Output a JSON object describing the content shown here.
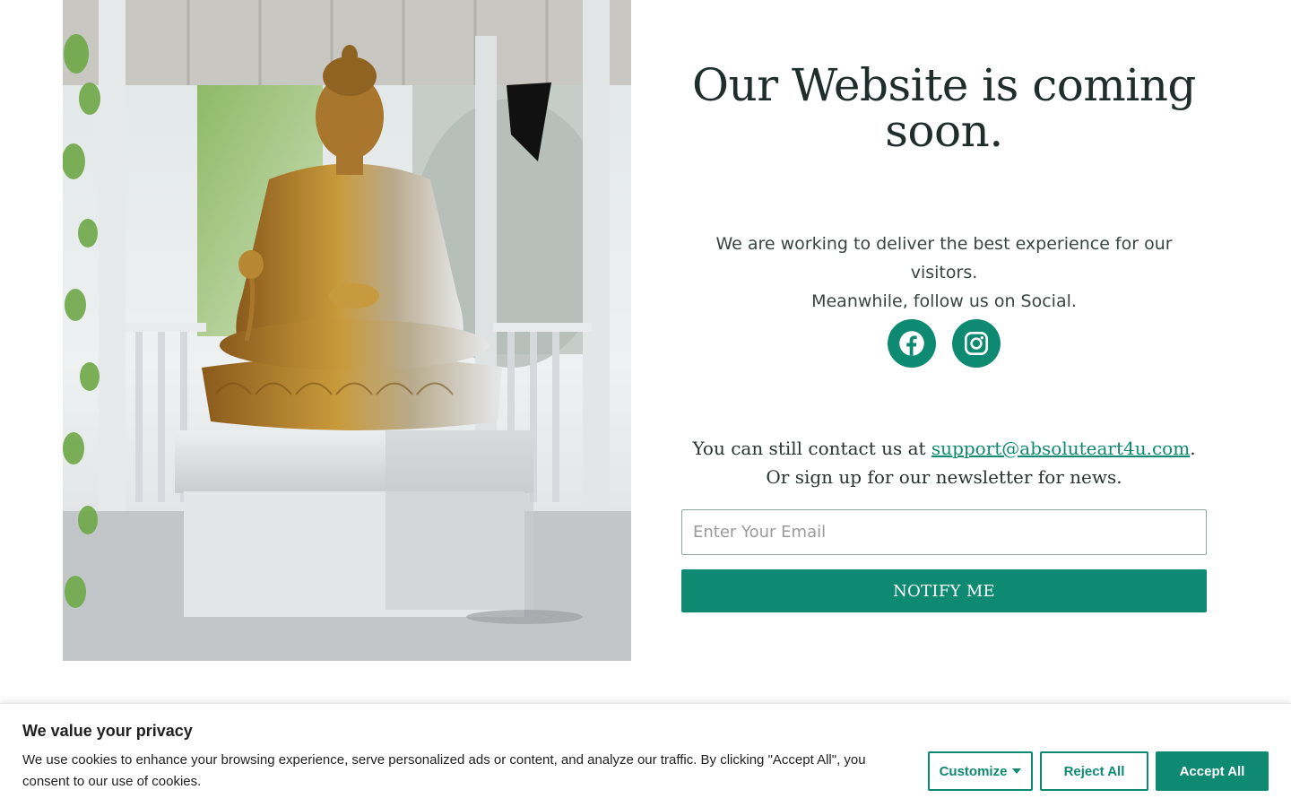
{
  "hero": {
    "alt": "Golden Buddha statue seated in a white gazebo surrounded by greenery"
  },
  "main": {
    "title": "Our Website is coming soon.",
    "intro_line1": "We are working to deliver the best experience for our visitors.",
    "intro_line2": "Meanwhile, follow us on Social.",
    "socials": [
      {
        "name": "facebook-icon",
        "label": "Facebook"
      },
      {
        "name": "instagram-icon",
        "label": "Instagram"
      }
    ],
    "contact_prefix": "You can still contact us at ",
    "contact_email": "support@absoluteart4u.com",
    "contact_suffix": ".",
    "newsletter_text": "Or sign up for our newsletter for news.",
    "email_placeholder": "Enter Your Email",
    "notify_label": "NOTIFY ME"
  },
  "cookie": {
    "title": "We value your privacy",
    "text": "We use cookies to enhance your browsing experience, serve personalized ads or content, and analyze our traffic. By clicking \"Accept All\", you consent to our use of cookies.",
    "customize_label": "Customize",
    "reject_label": "Reject All",
    "accept_label": "Accept All"
  },
  "colors": {
    "accent": "#0e8a72",
    "heading": "#1f2d2b",
    "text": "#3a4442"
  }
}
